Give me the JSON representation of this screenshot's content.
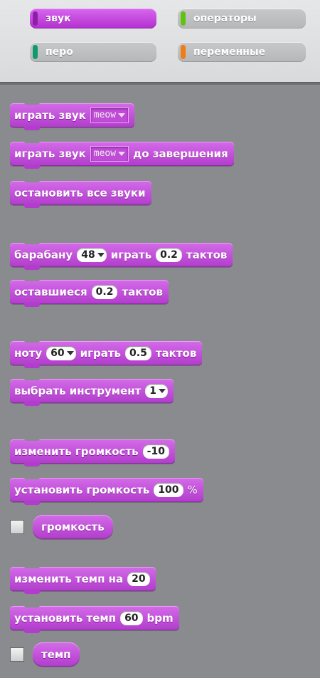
{
  "categories": [
    {
      "label": "звук",
      "color": "#cf63e9",
      "active": true
    },
    {
      "label": "операторы",
      "color": "#62c213",
      "active": false
    },
    {
      "label": "перо",
      "color": "#0e9a6c",
      "active": false
    },
    {
      "label": "переменные",
      "color": "#ee7d16",
      "active": false
    }
  ],
  "blocks": {
    "play_sound": {
      "text": "играть звук",
      "sound": "meow"
    },
    "play_sound_until_done": {
      "text_before": "играть звук",
      "sound": "meow",
      "text_after": "до завершения"
    },
    "stop_all_sounds": {
      "text": "остановить все звуки"
    },
    "play_drum": {
      "text_before": "барабану",
      "drum": "48",
      "text_mid": "играть",
      "beats": "0.2",
      "text_after": "тактов"
    },
    "rest": {
      "text_before": "оставшиеся",
      "beats": "0.2",
      "text_after": "тактов"
    },
    "play_note": {
      "text_before": "ноту",
      "note": "60",
      "text_mid": "играть",
      "beats": "0.5",
      "text_after": "тактов"
    },
    "set_instrument": {
      "text": "выбрать инструмент",
      "instrument": "1"
    },
    "change_volume": {
      "text": "изменить громкость",
      "value": "-10"
    },
    "set_volume": {
      "text": "установить громкость",
      "value": "100",
      "unit": "%"
    },
    "volume_reporter": {
      "text": "громкость"
    },
    "change_tempo": {
      "text": "изменить темп на",
      "value": "20"
    },
    "set_tempo": {
      "text": "установить темп",
      "value": "60",
      "unit": "bpm"
    },
    "tempo_reporter": {
      "text": "темп"
    }
  }
}
